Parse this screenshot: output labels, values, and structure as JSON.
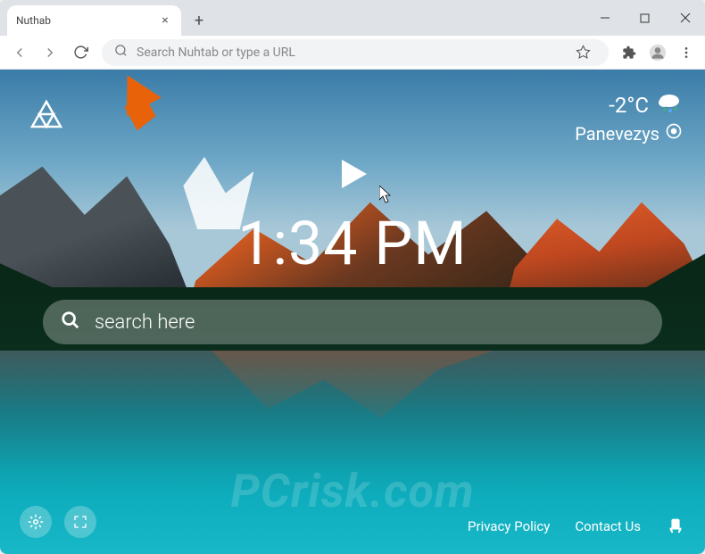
{
  "tab": {
    "title": "Nuthab"
  },
  "omnibox": {
    "placeholder": "Search Nuhtab or type a URL"
  },
  "weather": {
    "temperature": "-2°C",
    "location": "Panevezys"
  },
  "clock": {
    "time": "1:34 PM"
  },
  "search": {
    "placeholder": "search here"
  },
  "footer": {
    "privacy": "Privacy Policy",
    "contact": "Contact Us"
  },
  "watermark": "PCrisk.com"
}
